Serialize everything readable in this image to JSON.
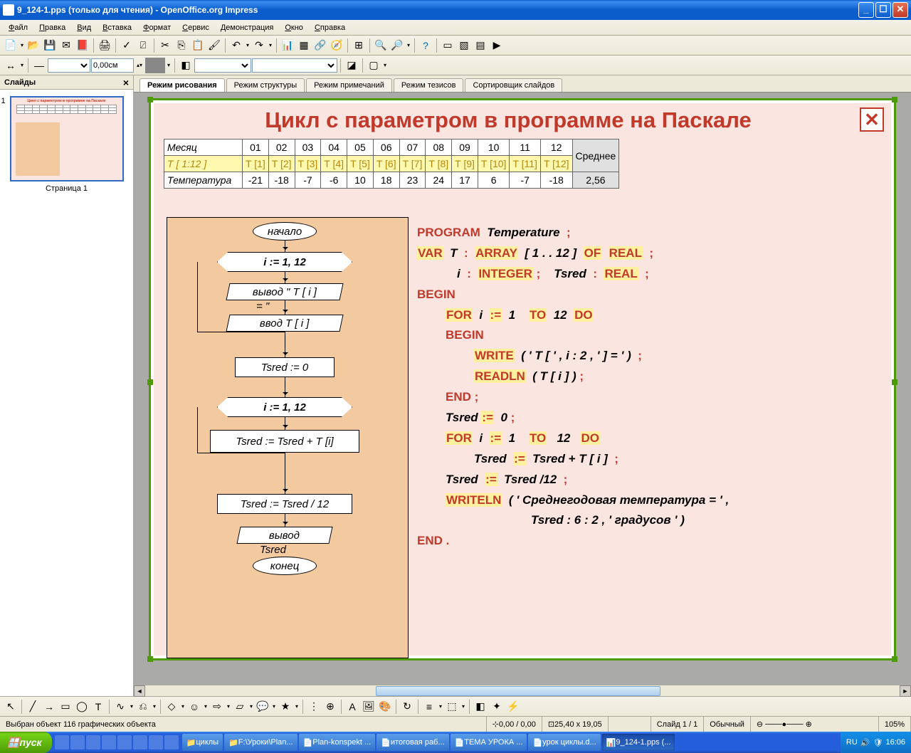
{
  "window": {
    "title": "9_124-1.pps (только для чтения) - OpenOffice.org Impress"
  },
  "menu": [
    "Файл",
    "Правка",
    "Вид",
    "Вставка",
    "Формат",
    "Сервис",
    "Демонстрация",
    "Окно",
    "Справка"
  ],
  "toolbar2": {
    "measure": "0,00см"
  },
  "slides_panel": {
    "title": "Слайды",
    "caption": "Страница 1",
    "num": "1"
  },
  "view_tabs": [
    "Режим рисования",
    "Режим структуры",
    "Режим примечаний",
    "Режим тезисов",
    "Сортировщик слайдов"
  ],
  "slide": {
    "title": "Цикл с параметром в программе на Паскале",
    "table": {
      "row1_head": "Месяц",
      "months": [
        "01",
        "02",
        "03",
        "04",
        "05",
        "06",
        "07",
        "08",
        "09",
        "10",
        "11",
        "12"
      ],
      "avg_head": "Среднее",
      "row2_head": "T [ 1:12 ]",
      "tindex": [
        "T [1]",
        "T [2]",
        "T [3]",
        "T [4]",
        "T [5]",
        "T [6]",
        "T [7]",
        "T [8]",
        "T [9]",
        "T [10]",
        "T [11]",
        "T [12]"
      ],
      "row3_head": "Температура",
      "temps": [
        "-21",
        "-18",
        "-7",
        "-6",
        "10",
        "18",
        "23",
        "24",
        "17",
        "6",
        "-7",
        "-18"
      ],
      "avg_val": "2,56"
    },
    "flow": {
      "start": "начало",
      "loop1": "i := 1, 12",
      "out1a": "вывод  \" T [ i ]",
      "out1b": "= \"",
      "in1": "ввод   T [ i ]",
      "init": "Tsred := 0",
      "loop2": "i := 1, 12",
      "sum": "Tsred := Tsred + T [i]",
      "div": "Tsred := Tsred / 12",
      "out2": "вывод",
      "out2b": "Tsred",
      "end": "конец"
    },
    "code": {
      "l1_prog": "PROGRAM",
      "l1_name": "Temperature",
      "semi": ";",
      "l2_var": "VAR",
      "l2_t": "T",
      "colon": ":",
      "l2_arr": "ARRAY",
      "l2_range": "[ 1 . . 12 ]",
      "l2_of": "OF",
      "l2_real": "REAL",
      "l3_i": "i",
      "l3_int": "INTEGER",
      "l3_ts": "Tsred",
      "begin": "BEGIN",
      "for": "FOR",
      "assign": ":=",
      "one": "1",
      "to": "TO",
      "twelve": "12",
      "do": "DO",
      "write": "WRITE",
      "write_arg": "( ' T [ ' , i : 2 , ' ] = ' )",
      "readln": "READLN",
      "readln_arg": "(  T [ i ]  )",
      "end_semi": "END ;",
      "ts_zero": "Tsred",
      "zero": "0",
      "sum_line": "Tsred + T [ i ]",
      "div_line": "Tsred /12",
      "writeln": "WRITELN",
      "writeln_arg1": "( ' Среднегодовая  температура =  ' ,",
      "writeln_arg2": "Tsred : 6 : 2 , '  градусов ' )",
      "end_dot": "END ."
    }
  },
  "statusbar": {
    "selected": "Выбран объект 116 графических объекта",
    "pos": "0,00 / 0,00",
    "size": "25,40 x 19,05",
    "slide": "Слайд 1 / 1",
    "layout": "Обычный",
    "zoom": "105%"
  },
  "taskbar": {
    "start": "пуск",
    "tasks": [
      {
        "label": "циклы"
      },
      {
        "label": "F:\\Уроки\\Plan..."
      },
      {
        "label": "Plan-konspekt ..."
      },
      {
        "label": "итоговая раб..."
      },
      {
        "label": "ТЕМА УРОКА ..."
      },
      {
        "label": "урок циклы.d..."
      },
      {
        "label": "9_124-1.pps (..."
      }
    ],
    "lang": "RU",
    "time": "16:06"
  }
}
